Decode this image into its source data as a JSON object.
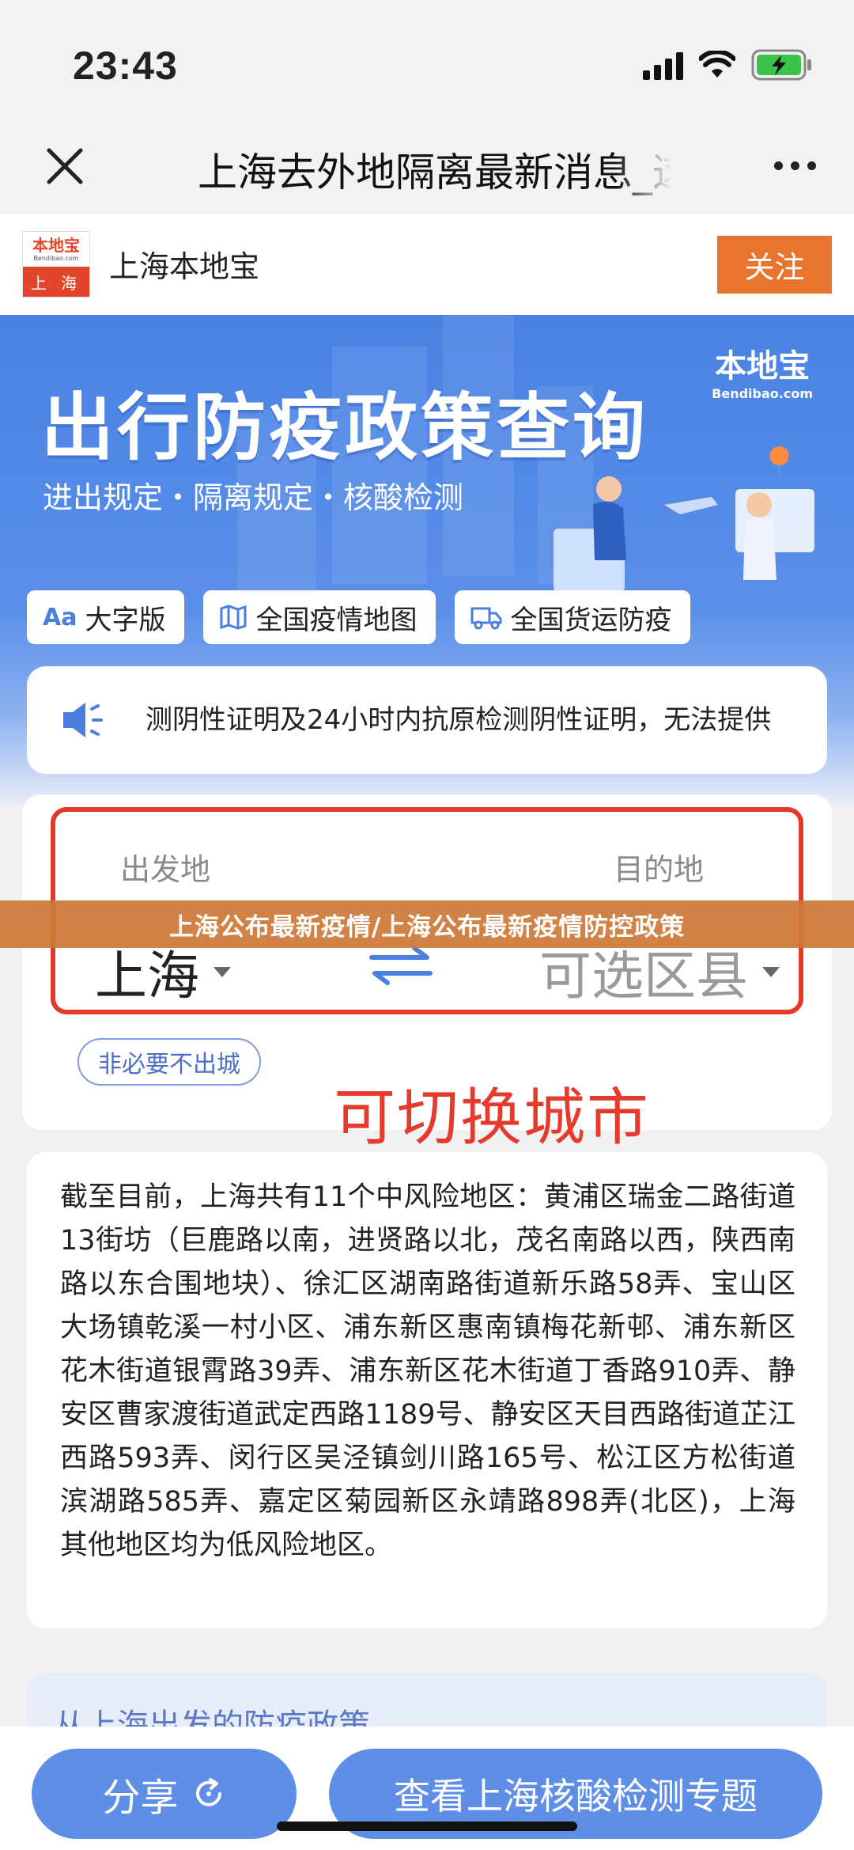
{
  "status": {
    "time": "23:43"
  },
  "nav": {
    "title": "上海去外地隔离最新消息_这"
  },
  "account": {
    "name": "上海本地宝",
    "follow_label": "关注",
    "avatar": {
      "brand": "本地宝",
      "domain": "Bendibao.com",
      "city": "上 海"
    }
  },
  "banner": {
    "title": "出行防疫政策查询",
    "subtitle": "进出规定・隔离规定・核酸检测",
    "logo_name": "本地宝",
    "logo_domain": "Bendibao.com",
    "chips": [
      {
        "icon": "font-size-icon",
        "label": "大字版"
      },
      {
        "icon": "map-icon",
        "label": "全国疫情地图"
      },
      {
        "icon": "truck-icon",
        "label": "全国货运防疫"
      }
    ]
  },
  "notice": {
    "text": "测阴性证明及24小时内抗原检测阴性证明，无法提供"
  },
  "route": {
    "origin_label": "出发地",
    "dest_label": "目的地",
    "origin_city": "上海",
    "dest_city": "可选区县",
    "stay_tag": "非必要不出城",
    "annotation": "可切换城市"
  },
  "overlay_caption": "上海公布最新疫情/上海公布最新疫情防控政策",
  "info": {
    "text": "截至目前，上海共有11个中风险地区：黄浦区瑞金二路街道13街坊（巨鹿路以南，进贤路以北，茂名南路以西，陕西南路以东合围地块）、徐汇区湖南路街道新乐路58弄、宝山区大场镇乾溪一村小区、浦东新区惠南镇梅花新邨、浦东新区花木街道银霄路39弄、浦东新区花木街道丁香路910弄、静安区曹家渡街道武定西路1189号、静安区天目西路街道芷江西路593弄、闵行区吴泾镇剑川路165号、松江区方松街道滨湖路585弄、嘉定区菊园新区永靖路898弄(北区)，上海其他地区均为低风险地区。"
  },
  "policy": {
    "header": "从上海出发的防疫政策"
  },
  "bottom": {
    "share_label": "分享",
    "topic_label": "查看上海核酸检测专题"
  },
  "colors": {
    "accent_blue": "#5f8ee6",
    "follow_orange": "#e8742e",
    "annotation_red": "#e33a2c"
  }
}
